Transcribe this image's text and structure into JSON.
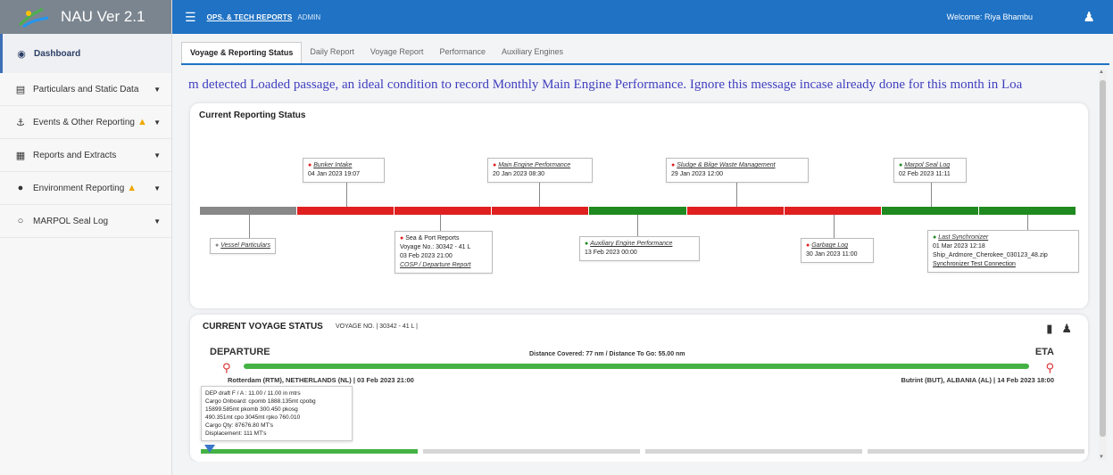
{
  "app": {
    "title": "NAU Ver 2.1"
  },
  "header": {
    "crumb1": "OPS. & TECH REPORTS",
    "crumb2": "ADMIN",
    "welcome": "Welcome: Riya Bhambu"
  },
  "sidebar": {
    "items": [
      {
        "label": "Dashboard",
        "icon": "dashboard-icon"
      },
      {
        "label": "Particulars and Static Data",
        "icon": "file-icon"
      },
      {
        "label": "Events & Other Reporting",
        "icon": "anchor-icon"
      },
      {
        "label": "Reports and Extracts",
        "icon": "report-icon"
      },
      {
        "label": "Environment Reporting",
        "icon": "globe-icon"
      },
      {
        "label": "MARPOL Seal Log",
        "icon": "circle-icon"
      }
    ]
  },
  "tabs": [
    "Voyage & Reporting Status",
    "Daily Report",
    "Voyage Report",
    "Performance",
    "Auxiliary Engines"
  ],
  "marquee": "m detected Loaded passage, an ideal condition to record Monthly Main Engine Performance. Ignore this message incase already done for this month in Loa",
  "status": {
    "title": "Current Reporting Status",
    "segments": [
      "#888888",
      "#e02020",
      "#e02020",
      "#e02020",
      "#1f8a1f",
      "#e02020",
      "#e02020",
      "#1f8a1f",
      "#1f8a1f"
    ],
    "events": {
      "vessel": {
        "link": "Vessel Particulars"
      },
      "bunker": {
        "link": "Bunker Intake",
        "date": "04 Jan 2023 19:07"
      },
      "sea": {
        "title": "Sea & Port Reports",
        "voyage": "Voyage No.: 30342 - 41 L",
        "date": "03 Feb 2023 21:00",
        "link": "COSP / Departure Report"
      },
      "mainengine": {
        "link": "Main Engine Performance",
        "date": "20 Jan 2023 08:30"
      },
      "aux": {
        "link": "Auxiliary Engine Performance",
        "date": "13 Feb 2023 00:00"
      },
      "sludge": {
        "link": "Sludge & Bilge Waste Management",
        "date": "29 Jan 2023 12:00"
      },
      "garbage": {
        "link": "Garbage Log",
        "date": "30 Jan 2023 11:00"
      },
      "marpol": {
        "link": "Marpol Seal Log",
        "date": "02 Feb 2023 11:11"
      },
      "sync": {
        "link": "Last Synchronizer",
        "date": "01 Mar 2023 12:18",
        "file": "Ship_Ardmore_Cherokee_030123_48.zip",
        "test": "Synchronizer Test Connection"
      }
    }
  },
  "voyage": {
    "title": "CURRENT VOYAGE STATUS",
    "voyage_no": "VOYAGE NO. | 30342 - 41 L |",
    "departure": "DEPARTURE",
    "eta": "ETA",
    "distance": "Distance Covered: 77 nm / Distance To Go: 55.00 nm",
    "from": "Rotterdam (RTM), NETHERLANDS (NL) | 03 Feb 2023 21:00",
    "to": "Butrint (BUT), ALBANIA (AL) | 14 Feb 2023 18:00",
    "details": [
      "DEP draft F / A : 11.00 / 11.00 in mtrs",
      "Cargo Onboard: cpomb 1888.135mt cpobg",
      "15899.585mt pkomb 300.450 pkosg",
      "490.351mt cpo 3045mt rpko 760.010",
      "Cargo Qty: 87676.80 MT's",
      "Displacement: 111 MT's"
    ]
  }
}
